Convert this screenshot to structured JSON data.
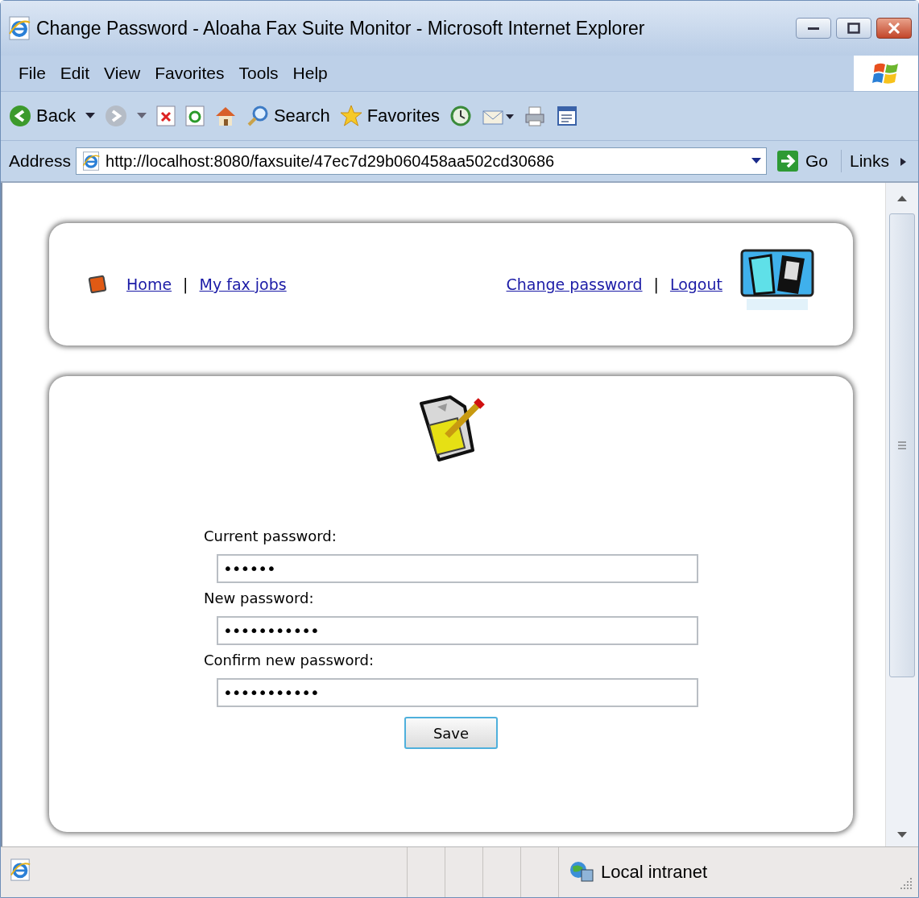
{
  "window": {
    "title": "Change Password - Aloaha Fax Suite Monitor - Microsoft Internet Explorer"
  },
  "menu": [
    "File",
    "Edit",
    "View",
    "Favorites",
    "Tools",
    "Help"
  ],
  "toolbar": {
    "back": "Back",
    "search": "Search",
    "favorites": "Favorites"
  },
  "address_bar": {
    "label": "Address",
    "url": "http://localhost:8080/faxsuite/47ec7d29b060458aa502cd30686",
    "go": "Go",
    "links": "Links"
  },
  "nav": {
    "left": [
      "Home",
      "My fax jobs"
    ],
    "right": [
      "Change password",
      "Logout"
    ],
    "separator": "|"
  },
  "form": {
    "fields": [
      {
        "label": "Current password:",
        "value": "••••••"
      },
      {
        "label": "New password:",
        "value": "•••••••••••"
      },
      {
        "label": "Confirm new password:",
        "value": "•••••••••••"
      }
    ],
    "button": "Save"
  },
  "status_bar": {
    "zone": "Local intranet"
  }
}
